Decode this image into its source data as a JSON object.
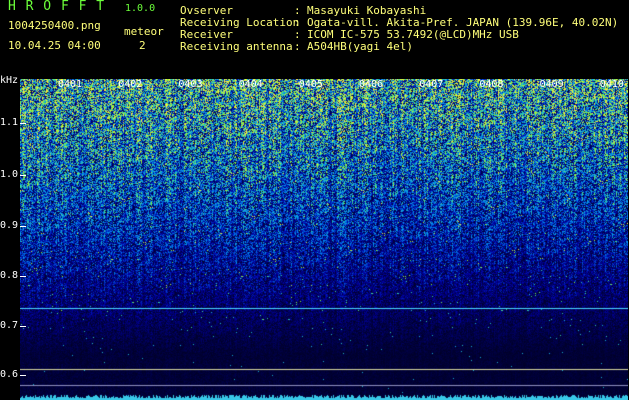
{
  "app": {
    "name": "H R O F F T",
    "version": "1.0.0"
  },
  "file": {
    "name": "1004250400.png",
    "datetime": "10.04.25 04:00"
  },
  "meteor": {
    "label": "meteor",
    "count": "2"
  },
  "info": [
    {
      "key": "Ovserver",
      "sep": ":",
      "value": "Masayuki Kobayashi"
    },
    {
      "key": "Receiving Location",
      "sep": ":",
      "value": "Ogata-vill. Akita-Pref. JAPAN (139.96E, 40.02N)"
    },
    {
      "key": "Receiver",
      "sep": ":",
      "value": "ICOM IC-575 53.7492(@LCD)MHz USB"
    },
    {
      "key": "Receiving antenna",
      "sep": ":",
      "value": "A504HB(yagi 4el)"
    }
  ],
  "yaxis": {
    "unit": "kHz",
    "ticks": [
      "1.1",
      "1.0",
      "0.9",
      "0.8",
      "0.7",
      "0.6"
    ]
  },
  "minute_marks": [
    "0401",
    "0402",
    "0403",
    "0404",
    "0405",
    "0406",
    "0407",
    "0408",
    "0409",
    "0410"
  ],
  "colors": {
    "header_green": "#6cff3a",
    "header_yellow": "#ffff7a",
    "background": "#000000",
    "reference_line": "#4ad8ff"
  }
}
